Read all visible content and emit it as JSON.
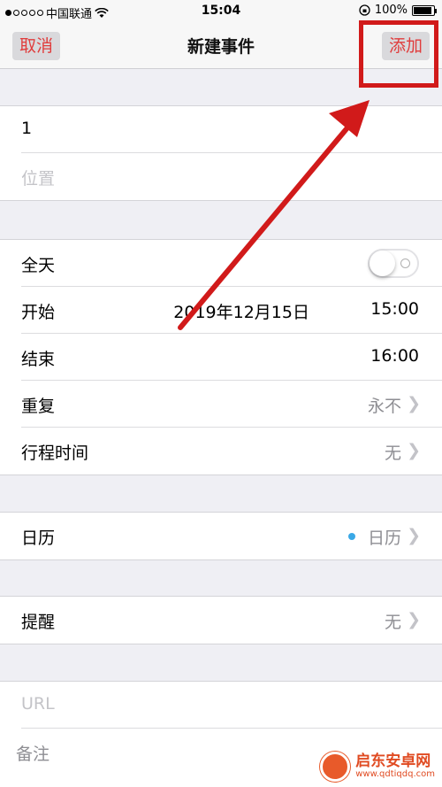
{
  "status_bar": {
    "carrier": "中国联通",
    "signal_dots_filled": 1,
    "signal_dots_total": 5,
    "time": "15:04",
    "battery_text": "100%"
  },
  "nav": {
    "cancel_label": "取消",
    "title": "新建事件",
    "add_label": "添加"
  },
  "event": {
    "title_value": "1",
    "location_placeholder": "位置"
  },
  "time_section": {
    "all_day_label": "全天",
    "all_day_on": false,
    "start_label": "开始",
    "start_date": "2019年12月15日",
    "start_time": "15:00",
    "end_label": "结束",
    "end_time": "16:00",
    "repeat_label": "重复",
    "repeat_value": "永不",
    "travel_label": "行程时间",
    "travel_value": "无"
  },
  "calendar_section": {
    "label": "日历",
    "value": "日历",
    "dot_color": "#3aa8e6"
  },
  "alert_section": {
    "label": "提醒",
    "value": "无"
  },
  "notes_section": {
    "url_placeholder": "URL",
    "notes_placeholder": "备注"
  },
  "watermark": {
    "name": "启东安卓网",
    "url": "www.qdtiqdq.com"
  },
  "colors": {
    "accent_red": "#e03c3c",
    "annotation_red": "#d11a1a"
  }
}
